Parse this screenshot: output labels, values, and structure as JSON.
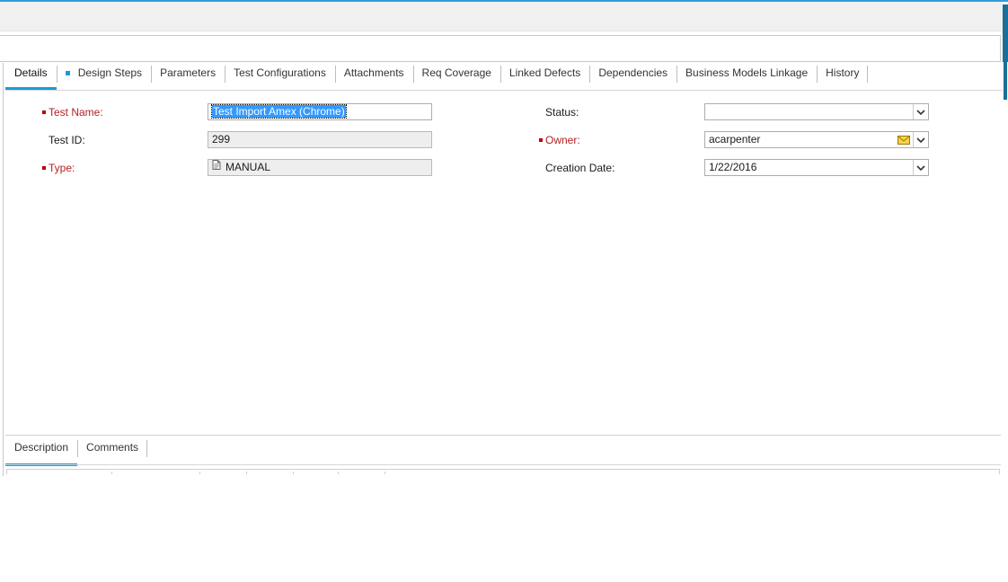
{
  "tabs": [
    {
      "label": "Details",
      "active": true,
      "marked": false
    },
    {
      "label": "Design Steps",
      "active": false,
      "marked": true
    },
    {
      "label": "Parameters",
      "active": false,
      "marked": false
    },
    {
      "label": "Test Configurations",
      "active": false,
      "marked": false
    },
    {
      "label": "Attachments",
      "active": false,
      "marked": false
    },
    {
      "label": "Req Coverage",
      "active": false,
      "marked": false
    },
    {
      "label": "Linked Defects",
      "active": false,
      "marked": false
    },
    {
      "label": "Dependencies",
      "active": false,
      "marked": false
    },
    {
      "label": "Business Models Linkage",
      "active": false,
      "marked": false
    },
    {
      "label": "History",
      "active": false,
      "marked": false
    }
  ],
  "fields": {
    "test_name": {
      "label": "Test Name:",
      "value": "Test Import  Amex (Chrome)",
      "required": true
    },
    "test_id": {
      "label": "Test ID:",
      "value": "299",
      "required": false
    },
    "type": {
      "label": "Type:",
      "value": "MANUAL",
      "required": true
    },
    "status": {
      "label": "Status:",
      "value": "",
      "required": false
    },
    "owner": {
      "label": "Owner:",
      "value": "acarpenter",
      "required": true
    },
    "creation_date": {
      "label": "Creation Date:",
      "value": "1/22/2016",
      "required": false
    }
  },
  "bottom_tabs": [
    {
      "label": "Description",
      "active": true
    },
    {
      "label": "Comments",
      "active": false
    }
  ],
  "icons": {
    "dropdown": "chevron-down-icon",
    "mail": "envelope-icon",
    "type": "document-icon"
  },
  "colors": {
    "accent": "#1a9ad6",
    "required_label": "#b22222",
    "selection": "#3399ff",
    "right_strip": "#1b6e99"
  }
}
